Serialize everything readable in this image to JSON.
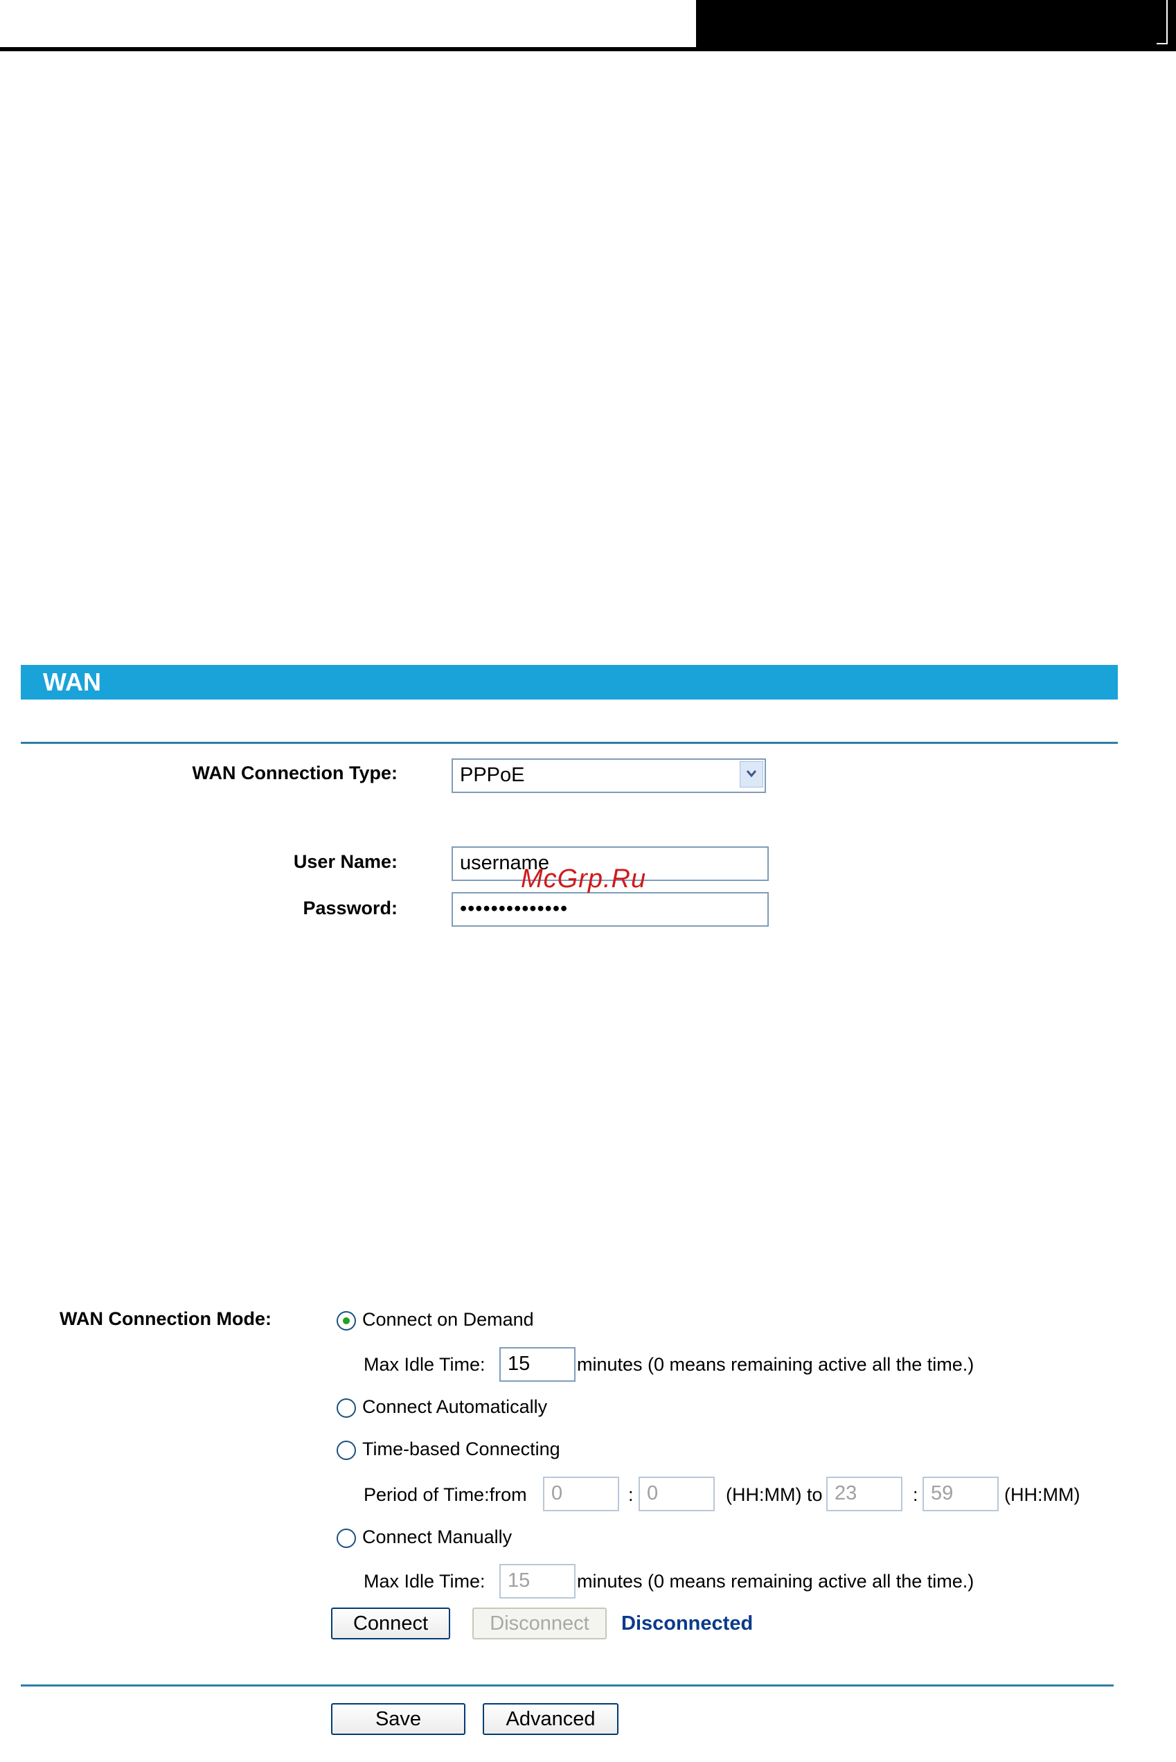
{
  "page_title": "WAN",
  "wan_type": {
    "label": "WAN Connection Type:",
    "value": "PPPoE"
  },
  "credentials": {
    "username_label": "User Name:",
    "username_value": "username",
    "password_label": "Password:",
    "password_value": "••••••••••••••"
  },
  "watermark": "McGrp.Ru",
  "mode": {
    "label": "WAN Connection Mode:",
    "options": [
      {
        "label": "Connect on Demand",
        "selected": true
      },
      {
        "label": "Connect Automatically",
        "selected": false
      },
      {
        "label": "Time-based Connecting",
        "selected": false
      },
      {
        "label": "Connect Manually",
        "selected": false
      }
    ],
    "demand_idle": {
      "label": "Max Idle Time:",
      "value": "15",
      "suffix": "minutes (0 means remaining active all the time.)"
    },
    "period": {
      "label": "Period of Time:from",
      "from_h": "0",
      "sep1": ":",
      "from_m": "0",
      "mid": "(HH:MM) to",
      "to_h": "23",
      "sep2": ":",
      "to_m": "59",
      "suffix": "(HH:MM)"
    },
    "manual_idle": {
      "label": "Max Idle Time:",
      "value": "15",
      "suffix": "minutes (0 means remaining active all the time.)"
    }
  },
  "actions": {
    "connect": "Connect",
    "disconnect": "Disconnect",
    "status": "Disconnected",
    "status_color": "#0a3a8c",
    "save": "Save",
    "advanced": "Advanced"
  },
  "colors": {
    "title_bar": "#1aa3d9",
    "rule": "#2f7fa6"
  }
}
